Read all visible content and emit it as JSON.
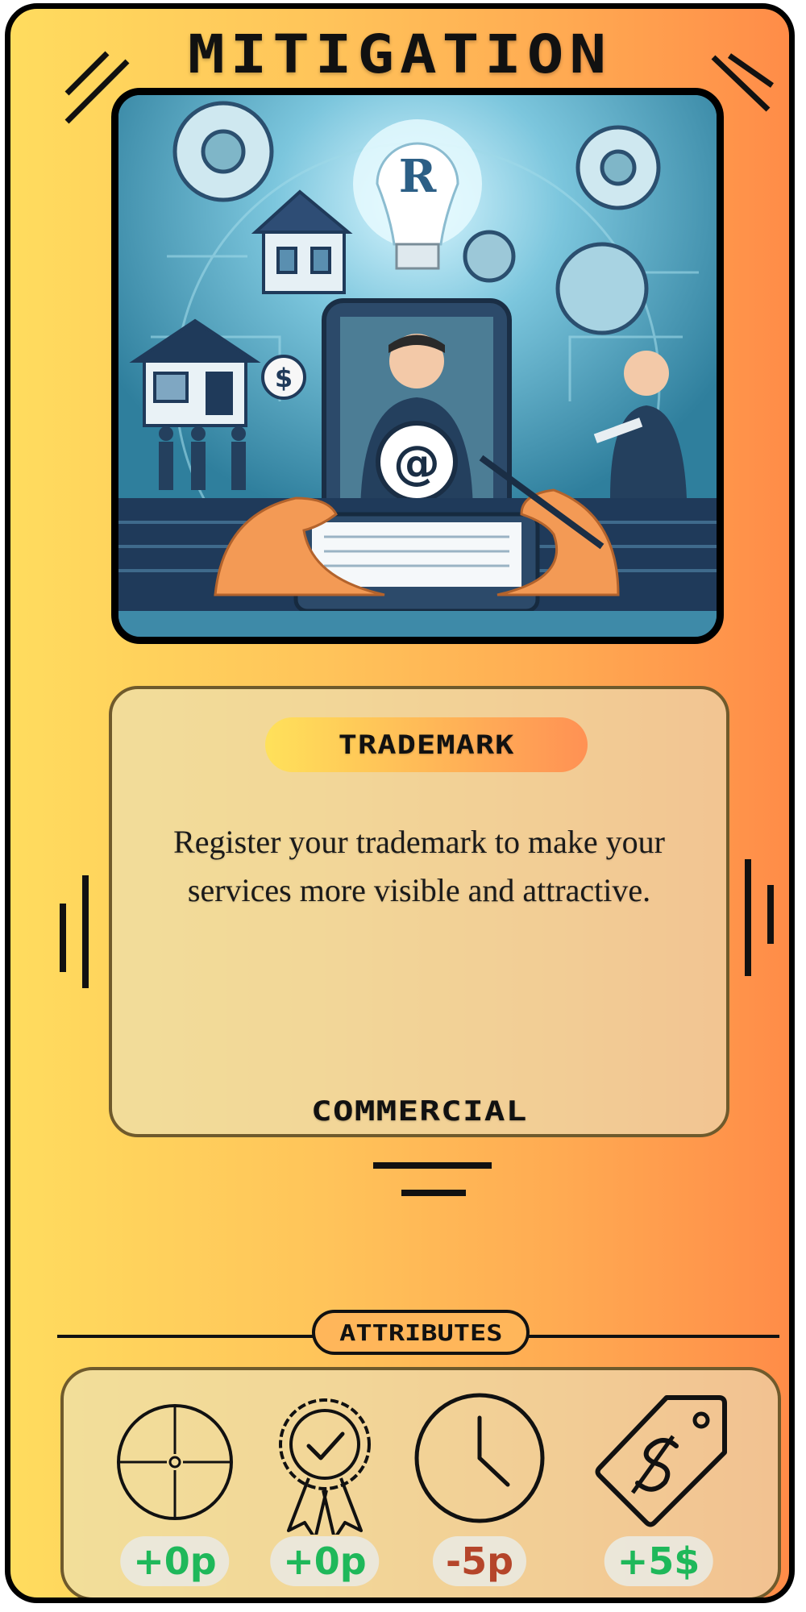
{
  "card": {
    "title": "MITIGATION",
    "image_alt": "Illustration of trademark registration with a lightbulb marked R, a businessman, tablet with @ symbol and hands signing a document",
    "image_letter": "R",
    "image_symbol": "@",
    "category_pill": "TRADEMARK",
    "description": "Register your trademark to make your services more visible and attractive.",
    "category": "COMMERCIAL",
    "attributes_label": "ATTRIBUTES"
  },
  "attributes": [
    {
      "icon": "crosshair-icon",
      "value": "+0p",
      "color": "#1fb85a"
    },
    {
      "icon": "award-badge-icon",
      "value": "+0p",
      "color": "#1fb85a"
    },
    {
      "icon": "clock-icon",
      "value": "-5p",
      "color": "#b5452a"
    },
    {
      "icon": "price-tag-icon",
      "value": "+5$",
      "color": "#1fb85a"
    }
  ],
  "colors": {
    "gradient_start": "#ffdc5e",
    "gradient_end": "#ff8c48",
    "border": "#000000",
    "positive": "#1fb85a",
    "negative": "#b5452a"
  }
}
